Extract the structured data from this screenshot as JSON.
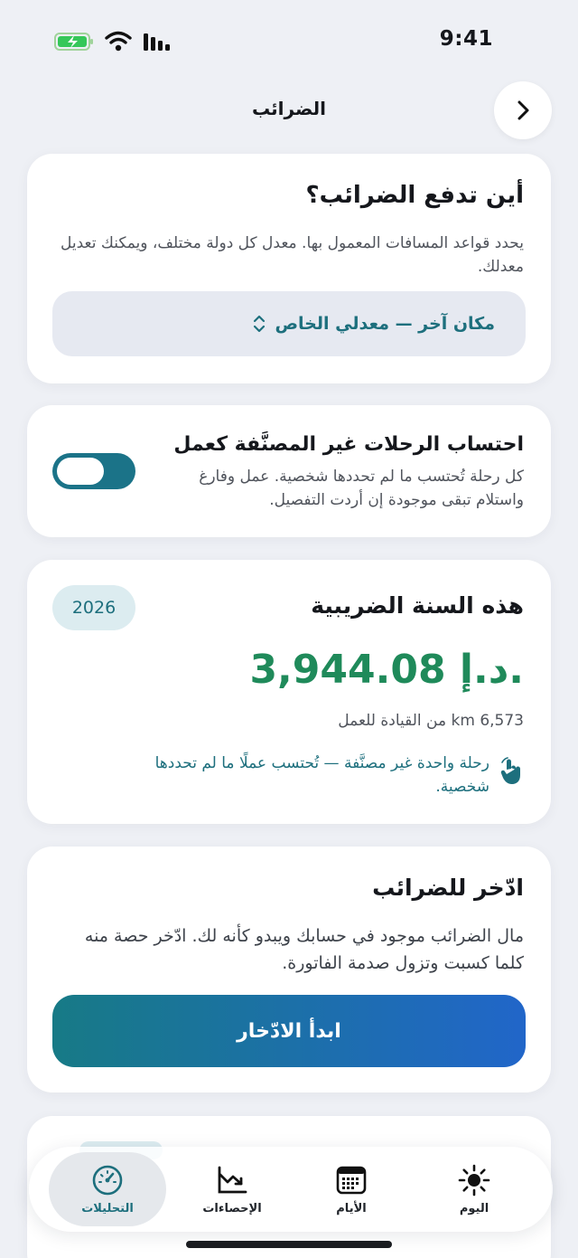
{
  "status_bar": {
    "time": "9:41"
  },
  "header": {
    "title": "الضرائب"
  },
  "jurisdiction": {
    "title": "أين تدفع الضرائب؟",
    "description": "يحدد قواعد المسافات المعمول بها. معدل كل دولة مختلف، ويمكنك تعديل معدلك.",
    "selected": "مكان آخر — معدلي الخاص"
  },
  "unclassified": {
    "title": "احتساب الرحلات غير المصنَّفة كعمل",
    "description": "كل رحلة تُحتسب ما لم تحددها شخصية. عمل وفارغ واستلام تبقى موجودة إن أردت التفصيل.",
    "enabled": true
  },
  "tax_year": {
    "title": "هذه السنة الضريبية",
    "year": "2026",
    "amount": "3,944.08 د.إ.",
    "distance": "6,573 km من القيادة للعمل",
    "note": "رحلة واحدة غير مصنَّفة — تُحتسب عملًا ما لم تحددها شخصية."
  },
  "save": {
    "title": "ادّخر للضرائب",
    "description": "مال الضرائب موجود في حسابك ويبدو كأنه لك. ادّخر حصة منه كلما كسبت وتزول صدمة الفاتورة.",
    "button": "ابدأ الادّخار"
  },
  "tabs": [
    {
      "label": "التحليلات",
      "icon": "gauge-icon",
      "active": true
    },
    {
      "label": "الإحصاءات",
      "icon": "chart-icon",
      "active": false
    },
    {
      "label": "الأيام",
      "icon": "calendar-icon",
      "active": false
    },
    {
      "label": "اليوم",
      "icon": "sun-icon",
      "active": false
    }
  ],
  "colors": {
    "accent": "#1d6f7d",
    "amount": "#1f8a5a",
    "toggle": "#1b7388",
    "button_start": "#177a86",
    "button_end": "#2166c9"
  }
}
